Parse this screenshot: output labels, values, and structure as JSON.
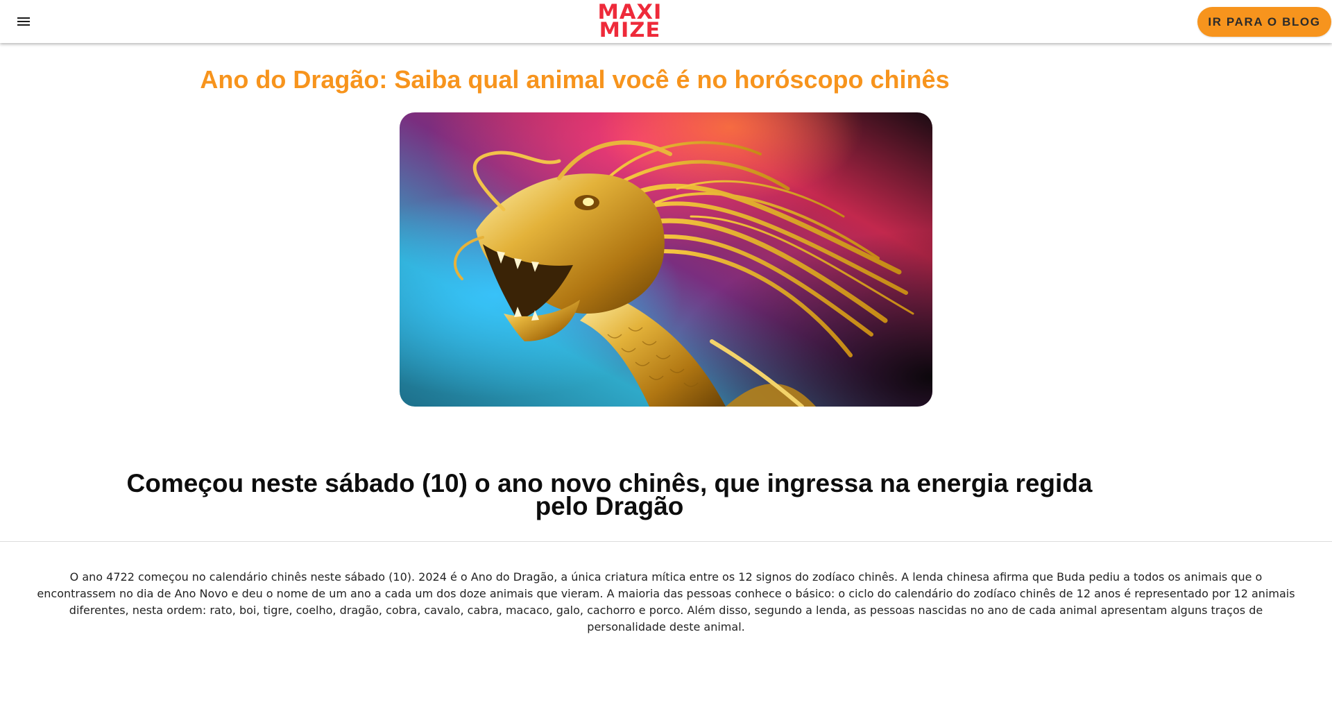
{
  "header": {
    "menu_icon": "hamburger-menu-icon",
    "logo_line1": "MAXI",
    "logo_line2": "MIZE",
    "logo_color": "#ee2a3a",
    "blog_button_label": "IR PARA O BLOG",
    "accent_color": "#f7941d"
  },
  "article": {
    "title": "Ano do Dragão: Saiba qual animal você é no horóscopo chinês",
    "hero_image": "golden-dragon-head-image",
    "subtitle": "Começou neste sábado (10) o ano novo chinês, que ingressa na energia regida pelo Dragão",
    "body": "O ano 4722 começou no calendário chinês neste sábado (10). 2024 é o Ano do Dragão, a única criatura mítica entre os 12 signos do zodíaco chinês. A lenda chinesa afirma que Buda pediu a todos os animais que o encontrassem no dia de Ano Novo e deu o nome de um ano a cada um dos doze animais que vieram. A maioria das pessoas conhece o básico: o ciclo do calendário do zodíaco chinês de 12 anos é representado por 12 animais diferentes, nesta ordem: rato, boi, tigre, coelho, dragão, cobra, cavalo, cabra, macaco, galo, cachorro e porco. Além disso, segundo a lenda, as pessoas nascidas no ano de cada animal apresentam alguns traços de personalidade deste animal."
  }
}
